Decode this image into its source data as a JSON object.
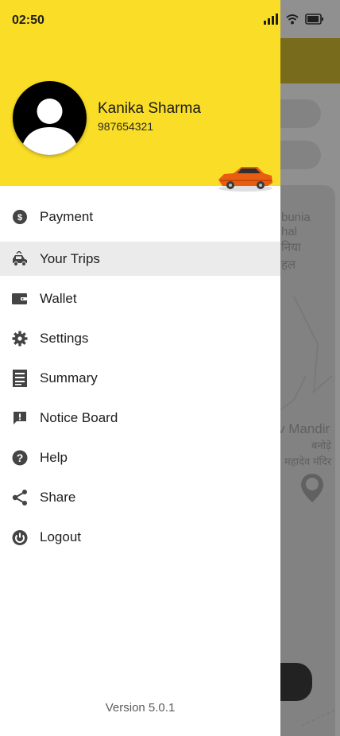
{
  "status": {
    "time": "02:50"
  },
  "user": {
    "name": "Kanika Sharma",
    "phone": "987654321"
  },
  "menu": [
    {
      "label": "Payment",
      "icon": "payment-icon"
    },
    {
      "label": "Your Trips",
      "icon": "car-icon",
      "active": true
    },
    {
      "label": "Wallet",
      "icon": "wallet-icon"
    },
    {
      "label": "Settings",
      "icon": "gear-icon"
    },
    {
      "label": "Summary",
      "icon": "document-icon"
    },
    {
      "label": "Notice Board",
      "icon": "notice-icon"
    },
    {
      "label": "Help",
      "icon": "help-icon"
    },
    {
      "label": "Share",
      "icon": "share-icon"
    },
    {
      "label": "Logout",
      "icon": "power-icon"
    }
  ],
  "version": "Version 5.0.1",
  "background_map": {
    "labels": [
      "bunia",
      "hal",
      "निया",
      "हल",
      "v Mandir",
      "बनोड़े",
      "महादेव मंदिर"
    ]
  },
  "colors": {
    "header": "#f9dd26",
    "active_row": "#ebebeb"
  }
}
